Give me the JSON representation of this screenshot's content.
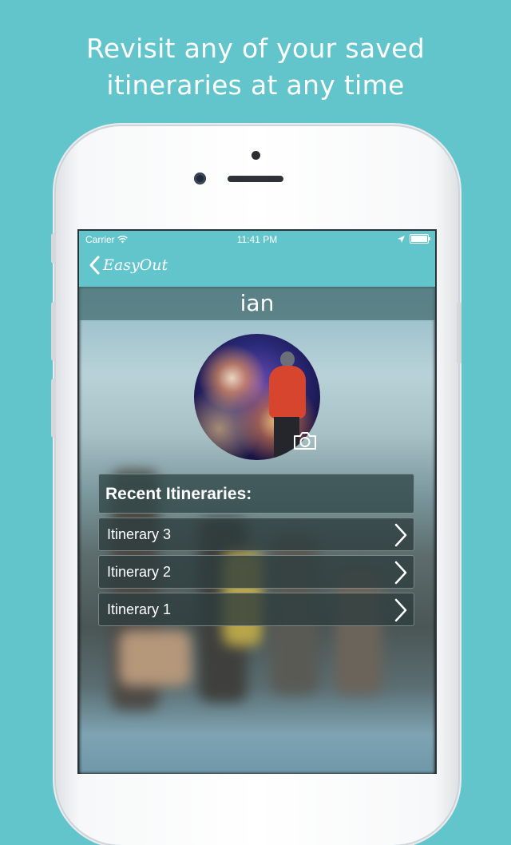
{
  "promo": {
    "line1": "Revisit any of your saved",
    "line2": "itineraries at any time"
  },
  "statusbar": {
    "carrier": "Carrier",
    "time": "11:41 PM"
  },
  "navbar": {
    "back_label": "EasyOut"
  },
  "profile": {
    "username": "ian"
  },
  "itineraries": {
    "header": "Recent Itineraries:",
    "items": [
      {
        "label": "Itinerary 3"
      },
      {
        "label": "Itinerary 2"
      },
      {
        "label": "Itinerary 1"
      }
    ]
  },
  "colors": {
    "background": "#63c5cc",
    "accent": "#63c5cc"
  },
  "icons": [
    "wifi-icon",
    "location-arrow-icon",
    "battery-icon",
    "back-chevron-icon",
    "camera-icon",
    "chevron-right-icon"
  ]
}
